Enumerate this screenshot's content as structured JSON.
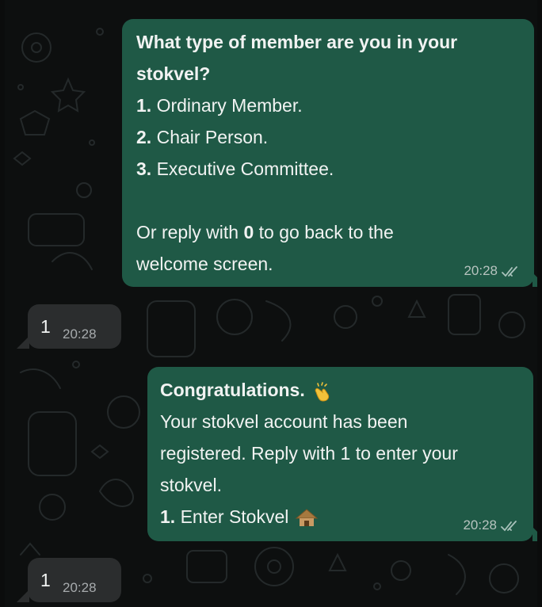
{
  "messages": [
    {
      "direction": "outgoing",
      "title_lines": [
        "What type of member are you in your",
        "stokvel?"
      ],
      "options": [
        {
          "num": "1.",
          "text": " Ordinary Member."
        },
        {
          "num": "2.",
          "text": " Chair Person."
        },
        {
          "num": "3.",
          "text": " Executive Committee."
        }
      ],
      "footer_before": "Or reply with ",
      "footer_bold": "0",
      "footer_after": " to go back to the",
      "footer_line2": "welcome screen.",
      "time": "20:28"
    },
    {
      "direction": "incoming",
      "text": "1",
      "time": "20:28"
    },
    {
      "direction": "outgoing",
      "title": "Congratulations.",
      "title_emoji": "clapping-hands-icon",
      "body_lines": [
        "Your stokvel account has been",
        "registered. Reply with 1 to enter your",
        "stokvel."
      ],
      "option": {
        "num": "1.",
        "text": " Enter Stokvel",
        "emoji": "hut-icon"
      },
      "time": "20:28"
    },
    {
      "direction": "incoming",
      "text": "1",
      "time": "20:28"
    }
  ],
  "colors": {
    "outgoing_bubble": "#1f5946",
    "incoming_bubble": "#2b2d2e",
    "background": "#0d0f0f",
    "read_ticks": "#a9c2bb"
  }
}
